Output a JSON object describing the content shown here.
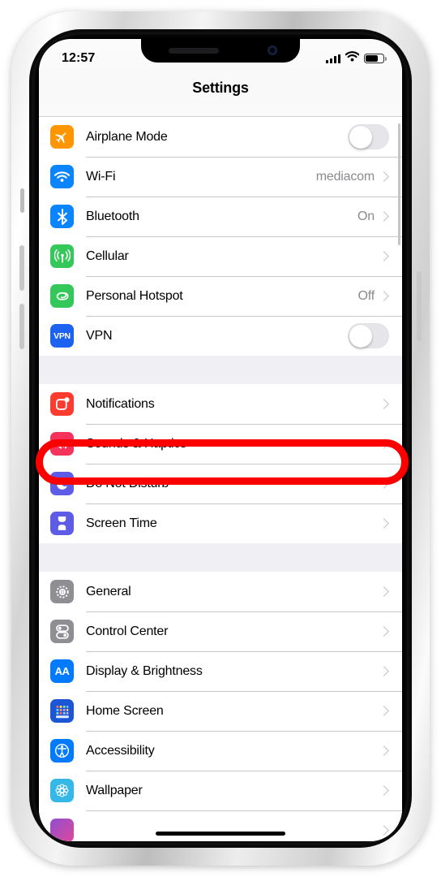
{
  "device": {
    "name": "iphone-11",
    "notch": {
      "speaker": "earpiece-speaker-slot",
      "camera": "front-camera"
    }
  },
  "status_bar": {
    "time": "12:57",
    "signal_icon": "cellular-signal-bars",
    "signal_bars": 4,
    "wifi_icon": "wifi-icon",
    "battery_icon": "battery-icon",
    "battery_level_percent": 62
  },
  "nav_bar": {
    "title": "Settings"
  },
  "annotation": {
    "type": "oval-highlight",
    "color": "#FC0000",
    "targets_row": "Sounds & Haptics"
  },
  "groups": [
    {
      "id": "connectivity",
      "rows": [
        {
          "label": "Airplane Mode",
          "icon": "airplane-icon",
          "color": "#FF9500",
          "accessory": "toggle",
          "toggle_on": false
        },
        {
          "label": "Wi-Fi",
          "icon": "wifi-icon",
          "color": "#0A84FF",
          "accessory": "chevron",
          "value": "mediacom"
        },
        {
          "label": "Bluetooth",
          "icon": "bluetooth-icon",
          "color": "#0A84FF",
          "accessory": "chevron",
          "value": "On"
        },
        {
          "label": "Cellular",
          "icon": "cellular-antenna-icon",
          "color": "#34C759",
          "accessory": "chevron",
          "value": ""
        },
        {
          "label": "Personal Hotspot",
          "icon": "hotspot-link-icon",
          "color": "#34C759",
          "accessory": "chevron",
          "value": "Off"
        },
        {
          "label": "VPN",
          "icon": "vpn-icon",
          "color": "#1B62F0",
          "accessory": "toggle",
          "toggle_on": false,
          "glyph_text": "VPN"
        }
      ]
    },
    {
      "id": "alerts",
      "rows": [
        {
          "label": "Notifications",
          "icon": "notifications-icon",
          "color": "#FF3B30",
          "accessory": "chevron",
          "value": ""
        },
        {
          "label": "Sounds & Haptics",
          "icon": "speaker-waves-icon",
          "color": "#F4325C",
          "accessory": "chevron",
          "value": "",
          "highlighted": true
        },
        {
          "label": "Do Not Disturb",
          "icon": "moon-icon",
          "color": "#5E5CE6",
          "accessory": "chevron",
          "value": ""
        },
        {
          "label": "Screen Time",
          "icon": "hourglass-icon",
          "color": "#5E5CE6",
          "accessory": "chevron",
          "value": ""
        }
      ]
    },
    {
      "id": "system",
      "rows": [
        {
          "label": "General",
          "icon": "gear-icon",
          "color": "#8E8E93",
          "accessory": "chevron",
          "value": ""
        },
        {
          "label": "Control Center",
          "icon": "control-center-icon",
          "color": "#8E8E93",
          "accessory": "chevron",
          "value": ""
        },
        {
          "label": "Display & Brightness",
          "icon": "display-brightness-icon",
          "color": "#007AFF",
          "accessory": "chevron",
          "value": "",
          "glyph_text": "AA"
        },
        {
          "label": "Home Screen",
          "icon": "home-screen-grid-icon",
          "color": "#1B56D6",
          "accessory": "chevron",
          "value": ""
        },
        {
          "label": "Accessibility",
          "icon": "accessibility-icon",
          "color": "#007AFF",
          "accessory": "chevron",
          "value": ""
        },
        {
          "label": "Wallpaper",
          "icon": "wallpaper-flower-icon",
          "color": "#35B8E8",
          "accessory": "chevron",
          "value": ""
        },
        {
          "label": "",
          "icon": "siri-icon",
          "color": "#8E4FD0",
          "accessory": "chevron",
          "value": "",
          "partial": true
        }
      ]
    }
  ]
}
